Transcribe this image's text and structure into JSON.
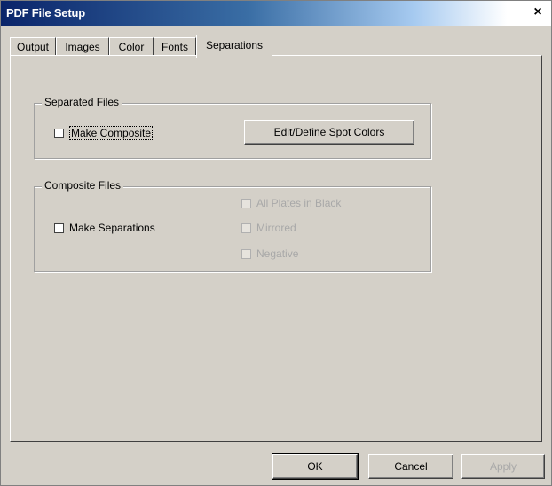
{
  "window": {
    "title": "PDF File Setup",
    "close_glyph": "×"
  },
  "tabs": [
    {
      "label": "Output"
    },
    {
      "label": "Images"
    },
    {
      "label": "Color"
    },
    {
      "label": "Fonts"
    },
    {
      "label": "Separations",
      "active": true
    }
  ],
  "separated_files": {
    "group_label": "Separated Files",
    "make_composite_label": "Make Composite",
    "make_composite_checked": false,
    "edit_spot_colors_label": "Edit/Define Spot Colors"
  },
  "composite_files": {
    "group_label": "Composite Files",
    "make_separations_label": "Make Separations",
    "make_separations_checked": false,
    "all_plates_label": "All Plates in Black",
    "mirrored_label": "Mirrored",
    "negative_label": "Negative"
  },
  "footer": {
    "ok_label": "OK",
    "cancel_label": "Cancel",
    "apply_label": "Apply"
  }
}
